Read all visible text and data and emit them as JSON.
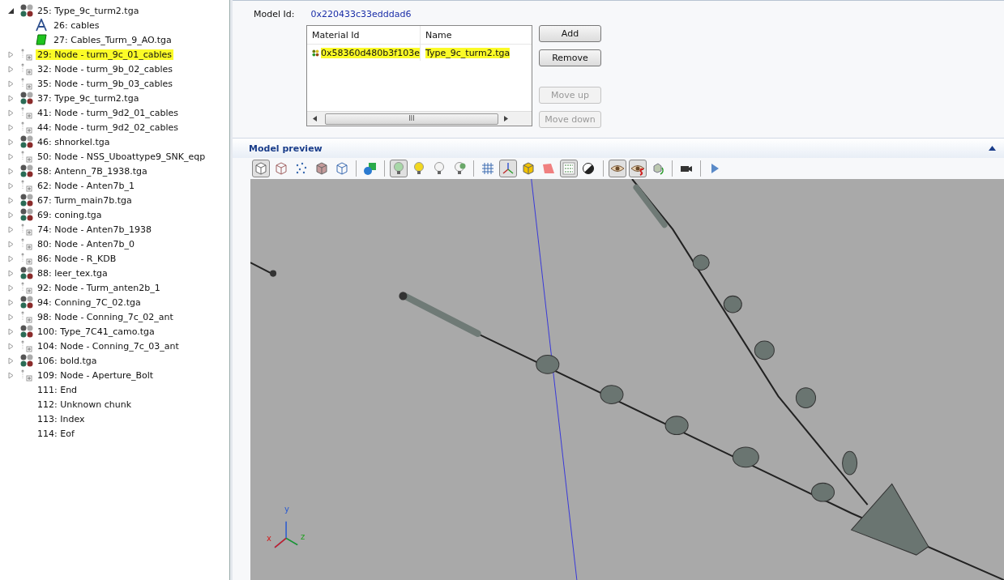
{
  "tree": [
    {
      "label": "25: Type_9c_turm2.tga",
      "kind": "material",
      "expanded": true,
      "highlighted": false,
      "children": [
        {
          "label": "26: cables",
          "kind": "text",
          "highlighted": false
        },
        {
          "label": "27: Cables_Turm_9_AO.tga",
          "kind": "texture",
          "highlighted": false
        }
      ]
    },
    {
      "label": "29: Node - turm_9c_01_cables",
      "kind": "node",
      "expanded": false,
      "highlighted": true
    },
    {
      "label": "32: Node - turm_9b_02_cables",
      "kind": "node",
      "expanded": false,
      "highlighted": false
    },
    {
      "label": "35: Node - turm_9b_03_cables",
      "kind": "node",
      "expanded": false,
      "highlighted": false
    },
    {
      "label": "37: Type_9c_turm2.tga",
      "kind": "material",
      "expanded": false,
      "highlighted": false
    },
    {
      "label": "41: Node - turm_9d2_01_cables",
      "kind": "node",
      "expanded": false,
      "highlighted": false
    },
    {
      "label": "44: Node - turm_9d2_02_cables",
      "kind": "node",
      "expanded": false,
      "highlighted": false
    },
    {
      "label": "46: shnorkel.tga",
      "kind": "material",
      "expanded": false,
      "highlighted": false
    },
    {
      "label": "50: Node - NSS_Uboattype9_SNK_eqp",
      "kind": "node",
      "expanded": false,
      "highlighted": false
    },
    {
      "label": "58: Antenn_7B_1938.tga",
      "kind": "material",
      "expanded": false,
      "highlighted": false
    },
    {
      "label": "62: Node - Anten7b_1",
      "kind": "node",
      "expanded": false,
      "highlighted": false
    },
    {
      "label": "67: Turm_main7b.tga",
      "kind": "material",
      "expanded": false,
      "highlighted": false
    },
    {
      "label": "69: coning.tga",
      "kind": "material",
      "expanded": false,
      "highlighted": false
    },
    {
      "label": "74: Node - Anten7b_1938",
      "kind": "node",
      "expanded": false,
      "highlighted": false
    },
    {
      "label": "80: Node - Anten7b_0",
      "kind": "node",
      "expanded": false,
      "highlighted": false
    },
    {
      "label": "86: Node - R_KDB",
      "kind": "node",
      "expanded": false,
      "highlighted": false
    },
    {
      "label": "88: leer_tex.tga",
      "kind": "material",
      "expanded": false,
      "highlighted": false
    },
    {
      "label": "92: Node - Turm_anten2b_1",
      "kind": "node",
      "expanded": false,
      "highlighted": false
    },
    {
      "label": "94: Conning_7C_02.tga",
      "kind": "material",
      "expanded": false,
      "highlighted": false
    },
    {
      "label": "98: Node - Conning_7c_02_ant",
      "kind": "node",
      "expanded": false,
      "highlighted": false
    },
    {
      "label": "100: Type_7C41_camo.tga",
      "kind": "material",
      "expanded": false,
      "highlighted": false
    },
    {
      "label": "104: Node - Conning_7c_03_ant",
      "kind": "node",
      "expanded": false,
      "highlighted": false
    },
    {
      "label": "106: bold.tga",
      "kind": "material",
      "expanded": false,
      "highlighted": false
    },
    {
      "label": "109: Node - Aperture_Bolt",
      "kind": "node",
      "expanded": false,
      "highlighted": false
    },
    {
      "label": "111: End",
      "kind": "plain",
      "highlighted": false
    },
    {
      "label": "112: Unknown chunk",
      "kind": "plain",
      "highlighted": false
    },
    {
      "label": "113: Index",
      "kind": "plain",
      "highlighted": false
    },
    {
      "label": "114: Eof",
      "kind": "plain",
      "highlighted": false
    }
  ],
  "model": {
    "label": "Model Id:",
    "value": "0x220433c33edddad6"
  },
  "materials": {
    "columns": [
      "Material Id",
      "Name"
    ],
    "rows": [
      {
        "id": "0x58360d480b3f103e",
        "name": "Type_9c_turm2.tga",
        "highlighted": true
      }
    ],
    "scroll_grip": "III"
  },
  "buttons": [
    {
      "label": "Add",
      "disabled": false
    },
    {
      "label": "Remove",
      "disabled": false
    },
    {
      "label": "Move up",
      "disabled": true
    },
    {
      "label": "Move down",
      "disabled": true
    }
  ],
  "preview": {
    "title": "Model preview",
    "toolbar": [
      [
        {
          "kind": "solid-cube",
          "pressed": true
        },
        {
          "kind": "wire-cube",
          "pressed": false
        },
        {
          "kind": "points",
          "pressed": false
        },
        {
          "kind": "shaded-cube",
          "pressed": false
        },
        {
          "kind": "blue-cube",
          "pressed": false
        }
      ],
      [
        {
          "kind": "shapes",
          "pressed": false
        }
      ],
      [
        {
          "kind": "bulb-green",
          "pressed": true
        },
        {
          "kind": "bulb-yellow",
          "pressed": false
        },
        {
          "kind": "bulb-white",
          "pressed": false
        },
        {
          "kind": "bulb-pair",
          "pressed": false
        }
      ],
      [
        {
          "kind": "grid",
          "pressed": false
        },
        {
          "kind": "axes",
          "pressed": true
        },
        {
          "kind": "yellow-cube",
          "pressed": false
        },
        {
          "kind": "plane",
          "pressed": false
        },
        {
          "kind": "xyz",
          "pressed": true
        },
        {
          "kind": "contrast",
          "pressed": false
        }
      ],
      [
        {
          "kind": "eye",
          "pressed": true
        },
        {
          "kind": "eye-s",
          "pressed": true
        },
        {
          "kind": "rotate",
          "pressed": false
        }
      ],
      [
        {
          "kind": "camera",
          "pressed": false
        }
      ],
      [
        {
          "kind": "play",
          "pressed": false
        }
      ]
    ],
    "axes": {
      "y": "y",
      "x": "x",
      "z": "z"
    }
  }
}
